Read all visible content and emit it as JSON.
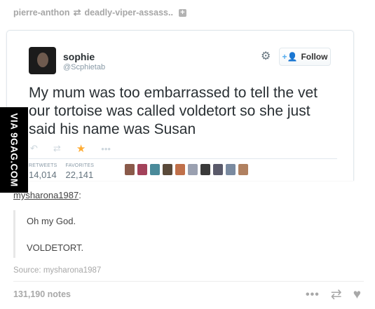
{
  "reblog_header": {
    "user": "pierre-anthon",
    "reblogged_from": "deadly-viper-assass.."
  },
  "tweet": {
    "name": "sophie",
    "handle": "@Scphietab",
    "follow_label": "Follow",
    "text": "My mum was too embarrassed to tell the vet our tortoise was called voldetort so she just said his name was Susan",
    "retweets_label": "RETWEETS",
    "retweets_value": "14,014",
    "favorites_label": "FAVORITES",
    "favorites_value": "22,141",
    "favoriter_avatar_colors": [
      "#8a5a4a",
      "#a3425a",
      "#4a8a9a",
      "#5a4a3a",
      "#c0704a",
      "#9aa0b0",
      "#3a3a3a",
      "#5a5a6a",
      "#7a8aa0",
      "#b08060"
    ]
  },
  "watermark": "VIA 9GAG.COM",
  "reblogger": {
    "username": "mysharona1987",
    "suffix": ":"
  },
  "quote": {
    "line1": "Oh my God.",
    "line2": "VOLDETORT."
  },
  "source": "Source: mysharona1987",
  "notes": "131,190 notes",
  "icons": {
    "reblog_header": "reblog-arrows-icon",
    "gear": "gear-icon",
    "footer": [
      "more-icon",
      "reblog-icon",
      "like-icon"
    ]
  },
  "colors": {
    "tweet_text": "#292f33",
    "follow_accent": "#55acee",
    "favorite_star": "#ffac33",
    "muted": "#a8a8a8"
  }
}
